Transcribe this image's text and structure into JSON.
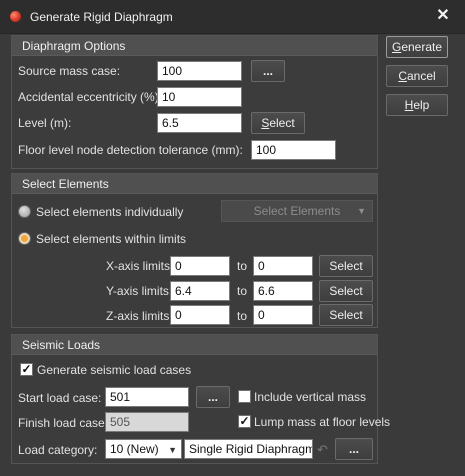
{
  "window": {
    "title": "Generate Rigid Diaphragm",
    "close_glyph": "✕"
  },
  "side_buttons": {
    "generate": {
      "prefix": "",
      "accel": "G",
      "rest": "enerate"
    },
    "cancel": {
      "prefix": "",
      "accel": "C",
      "rest": "ancel"
    },
    "help": {
      "prefix": "",
      "accel": "H",
      "rest": "elp"
    }
  },
  "diaphragm": {
    "title": "Diaphragm Options",
    "source_label": "Source mass case:",
    "source_value": "100",
    "browse_label": "...",
    "ecc_label": "Accidental eccentricity (%):",
    "ecc_value": "10",
    "level_label": "Level (m):",
    "level_value": "6.5",
    "select_prefix": "",
    "select_accel": "S",
    "select_rest": "elect",
    "tol_label": "Floor level node detection tolerance (mm):",
    "tol_value": "100"
  },
  "select_elements": {
    "title": "Select Elements",
    "option_individually": "Select elements individually",
    "select_elements_btn": "Select Elements",
    "option_limits": "Select elements within limits",
    "selected_option": "limits",
    "to_label": "to",
    "select_label": "Select",
    "rows": [
      {
        "label": "X-axis limits:",
        "from": "0",
        "to": "0"
      },
      {
        "label": "Y-axis limits:",
        "from": "6.4",
        "to": "6.6"
      },
      {
        "label": "Z-axis limits:",
        "from": "0",
        "to": "0"
      }
    ]
  },
  "seismic": {
    "title": "Seismic Loads",
    "generate_label": "Generate seismic load cases",
    "generate_checked": true,
    "start_label": "Start load case:",
    "start_value": "501",
    "browse_label": "...",
    "include_vertical_label": "Include vertical mass",
    "include_vertical_checked": false,
    "finish_label": "Finish load case:",
    "finish_value": "505",
    "lump_label": "Lump mass at floor levels",
    "lump_checked": true,
    "category_label": "Load category:",
    "category_value": "10 (New)",
    "category_name": "Single Rigid Diaphragm Ge",
    "cat_browse_label": "..."
  },
  "colors": {
    "accent": "#f1a43a",
    "background": "#3a3a3a",
    "header": "#505050"
  },
  "icons": {
    "app": "app-icon",
    "close": "close-icon",
    "dropdown": "chevron-down-icon",
    "undo": "undo-icon"
  }
}
